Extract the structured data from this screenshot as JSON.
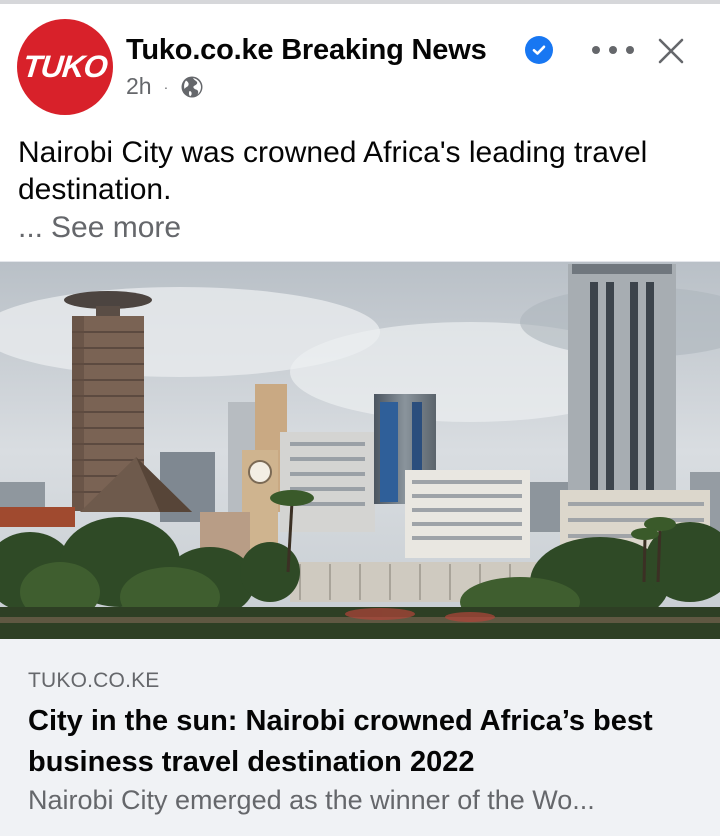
{
  "post": {
    "page_name": "Tuko.co.ke Breaking News",
    "avatar_logo_text": "TUKO",
    "verified_icon": "verified-check-icon",
    "time": "2h",
    "separator": "·",
    "audience_icon": "globe-icon",
    "more_icon": "more-horizontal-icon",
    "close_icon": "close-icon",
    "text": "Nairobi City was crowned Africa's leading travel destination.",
    "see_more_ellipsis": "...",
    "see_more_label": "See more"
  },
  "link_preview": {
    "domain": "TUKO.CO.KE",
    "headline": "City in the sun: Nairobi crowned Africa’s best business travel destination 2022",
    "description": "Nairobi City emerged as the winner of the Wo..."
  },
  "colors": {
    "brand_red": "#d8212a",
    "verified_blue": "#1877f2",
    "secondary_text": "#65676b",
    "card_background": "#f0f2f5"
  }
}
